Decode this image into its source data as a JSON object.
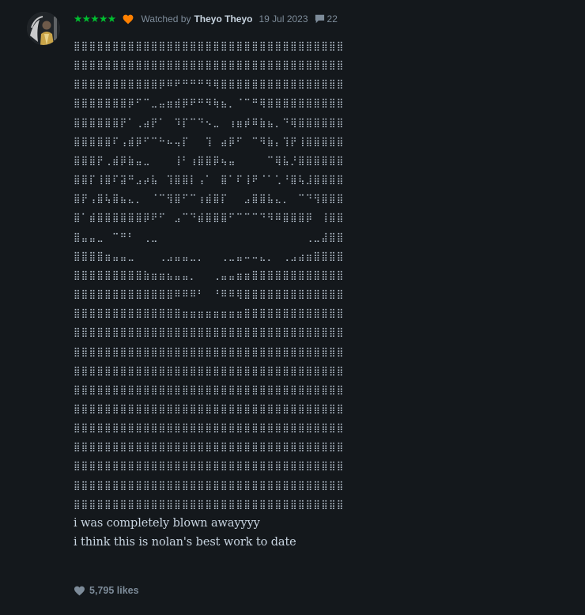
{
  "review": {
    "rating_stars": "★★★★★",
    "liked_icon": "heart-icon",
    "watched_prefix": "Watched by",
    "reviewer_name": "Theyo Theyo",
    "watched_date": "19 Jul 2023",
    "comment_icon": "speech-bubble-icon",
    "comment_count": "22",
    "ascii_art": "⣿⣿⣿⣿⣿⣿⣿⣿⣿⣿⣿⣿⣿⣿⣿⣿⣿⣿⣿⣿⣿⣿⣿⣿⣿⣿⣿⣿⣿⣿⣿⣿⣿⣿⣿\n⣿⣿⣿⣿⣿⣿⣿⣿⣿⣿⣿⣿⣿⣿⣿⣿⣿⣿⣿⣿⣿⣿⣿⣿⣿⣿⣿⣿⣿⣿⣿⣿⣿⣿⣿\n⣿⣿⣿⣿⣿⣿⣿⣿⣿⣿⣿⡿⠿⠟⠛⠛⠛⠻⢿⣿⣿⣿⣿⣿⣿⣿⣿⣿⣿⣿⣿⣿⣿⣿⣿\n⣿⣿⣿⣿⣿⣿⣿⡿⠋⠉⣀⣤⣶⣾⡿⠟⠛⠻⢷⣦⡀⠈⠉⠛⢿⣿⣿⣿⣿⣿⣿⣿⣿⣿⣿\n⣿⣿⣿⣿⣿⣿⡟⠁⢀⣴⡟⠁⠀⠹⡏⠉⠙⠢⣀⠀⢰⣶⡾⠿⣷⣦⡀⠙⢿⣿⣿⣿⣿⣿⣿\n⣿⣿⣿⣿⣿⠏⢠⣾⡿⠋⠉⠓⠦⢤⡏⠀⠀⢹⠀⣴⡿⠋⠀⠉⠻⣷⡄⢹⡟⢸⣿⣿⣿⣿⣿\n⣿⣿⣿⡟⢀⣾⡿⣷⣤⣀⠀⠀⠀⢸⠃⢰⣿⣿⡿⢦⣤⠀⠀⠀⠀⠉⢿⣧⡘⣿⣿⣿⣿⣿⣿\n⣿⣿⡏⢸⣿⠏⣽⠛⣠⡴⣧⠀⢹⣿⣿⡇⢠⠁⠀⣿⠁⠏⢸⠟⠈⠁⢁⠘⣿⢧⣸⣿⣿⣿⣿\n⣿⡟⢠⣿⢧⣿⣦⣄⡀⠀⠈⠉⢻⣿⠋⠉⢰⣾⣿⡏⠀⠀⣠⣿⣿⣧⣄⡀⠀⠉⠙⢻⣿⣿⣿\n⣿⠁⣾⣿⣿⣿⣿⣿⣿⡿⠟⠋⠀⣠⠉⠙⣾⣿⣿⣿⠋⠉⠉⠉⠙⠻⠿⣿⣿⣿⡿⠀⢸⣿⣿\n⣿⣤⣤⣀⠀⠉⠛⠃⠀⢀⣀⠀⠀⠀⠀⠀⠀⠀⠀⠀⠀⠀⠀⠀⠀⠀⠀⠀⠀⠀⢀⣀⣼⣿⣿\n⣿⣿⣿⣿⣶⣤⣤⣀⠀⠀⠀⢀⣠⣤⣤⣀⡀⠀⠀⢀⣀⣤⠤⠤⣄⡀⠀⢀⣠⣴⣶⣿⣿⣿⣿\n⣿⣿⣿⣿⣿⣿⣿⣿⣿⣷⣶⣶⣦⣤⣤⡀⠀⠀⢀⣤⣤⣶⣶⣿⣿⣿⣿⣿⣿⣿⣿⣿⣿⣿⣿\n⣿⣿⣿⣿⣿⣿⣿⣿⣿⣿⣿⣿⣿⠿⠿⠿⠃⠀⠘⠿⠿⢿⣿⣿⣿⣿⣿⣿⣿⣿⣿⣿⣿⣿⣿\n⣿⣿⣿⣿⣿⣿⣿⣿⣿⣿⣿⣿⣿⣿⣶⣶⣶⣶⣶⣶⣶⣶⣿⣿⣿⣿⣿⣿⣿⣿⣿⣿⣿⣿⣿\n⣿⣿⣿⣿⣿⣿⣿⣿⣿⣿⣿⣿⣿⣿⣿⣿⣿⣿⣿⣿⣿⣿⣿⣿⣿⣿⣿⣿⣿⣿⣿⣿⣿⣿⣿\n⣿⣿⣿⣿⣿⣿⣿⣿⣿⣿⣿⣿⣿⣿⣿⣿⣿⣿⣿⣿⣿⣿⣿⣿⣿⣿⣿⣿⣿⣿⣿⣿⣿⣿⣿\n⣿⣿⣿⣿⣿⣿⣿⣿⣿⣿⣿⣿⣿⣿⣿⣿⣿⣿⣿⣿⣿⣿⣿⣿⣿⣿⣿⣿⣿⣿⣿⣿⣿⣿⣿\n⣿⣿⣿⣿⣿⣿⣿⣿⣿⣿⣿⣿⣿⣿⣿⣿⣿⣿⣿⣿⣿⣿⣿⣿⣿⣿⣿⣿⣿⣿⣿⣿⣿⣿⣿\n⣿⣿⣿⣿⣿⣿⣿⣿⣿⣿⣿⣿⣿⣿⣿⣿⣿⣿⣿⣿⣿⣿⣿⣿⣿⣿⣿⣿⣿⣿⣿⣿⣿⣿⣿\n⣿⣿⣿⣿⣿⣿⣿⣿⣿⣿⣿⣿⣿⣿⣿⣿⣿⣿⣿⣿⣿⣿⣿⣿⣿⣿⣿⣿⣿⣿⣿⣿⣿⣿⣿\n⣿⣿⣿⣿⣿⣿⣿⣿⣿⣿⣿⣿⣿⣿⣿⣿⣿⣿⣿⣿⣿⣿⣿⣿⣿⣿⣿⣿⣿⣿⣿⣿⣿⣿⣿\n⣿⣿⣿⣿⣿⣿⣿⣿⣿⣿⣿⣿⣿⣿⣿⣿⣿⣿⣿⣿⣿⣿⣿⣿⣿⣿⣿⣿⣿⣿⣿⣿⣿⣿⣿\n⣿⣿⣿⣿⣿⣿⣿⣿⣿⣿⣿⣿⣿⣿⣿⣿⣿⣿⣿⣿⣿⣿⣿⣿⣿⣿⣿⣿⣿⣿⣿⣿⣿⣿⣿\n⣿⣿⣿⣿⣿⣿⣿⣿⣿⣿⣿⣿⣿⣿⣿⣿⣿⣿⣿⣿⣿⣿⣿⣿⣿⣿⣿⣿⣿⣿⣿⣿⣿⣿⣿",
    "text_lines": [
      "i was completely blown awayyyy",
      "i think this is nolan's best work to date"
    ],
    "like_count_text": "5,795 likes"
  },
  "colors": {
    "background": "#14181c",
    "star_green": "#00c030",
    "heart_orange": "#ff8000",
    "muted": "#7d8b99",
    "text": "#c8d4e0"
  }
}
